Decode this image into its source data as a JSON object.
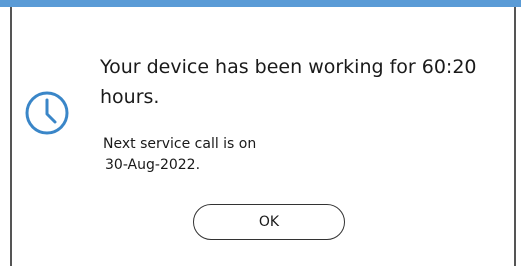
{
  "dialog": {
    "icon": "clock-icon",
    "message_line1": "Your device has been working for 60:20",
    "message_line2": "hours.",
    "service_line1": "Next service call is on",
    "service_line2": "30-Aug-2022.",
    "ok_label": "OK"
  },
  "colors": {
    "accent": "#5a9bd6",
    "icon": "#3a86c8",
    "text": "#1a1a1a",
    "border": "#555555"
  }
}
